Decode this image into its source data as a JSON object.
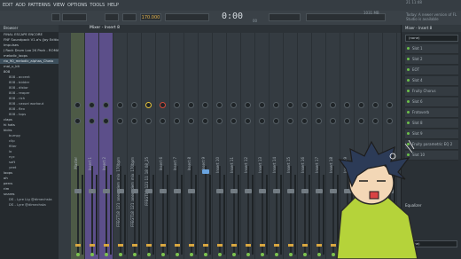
{
  "menubar": {
    "items": [
      "EDIT",
      "ADD",
      "PATTERNS",
      "VIEW",
      "OPTIONS",
      "TOOLS",
      "HELP"
    ]
  },
  "toolbar": {
    "bpm": "170.000",
    "time_main": "0:00",
    "time_small": "00",
    "song_pos": "21 11:48",
    "cpu": "1031 MB",
    "hint": "Today: A newer version of FL Studio is available"
  },
  "browser": {
    "title": "Browser",
    "rows": [
      {
        "label": "FINAL ESCAPE ENCORE",
        "folder": true
      },
      {
        "label": "FNF Soundpack V1.a's (Joy Edition)",
        "folder": true
      },
      {
        "label": "Impulses",
        "folder": true
      },
      {
        "label": "J Rock Drum Loo 2K Pack - ROMANDE",
        "folder": true
      },
      {
        "label": "melodic_loops",
        "folder": true
      },
      {
        "label": "rio_90_melodic_alphas_Chwio",
        "folder": true,
        "sel": true
      },
      {
        "label": "mal_u_kit",
        "folder": true
      },
      {
        "label": "808",
        "folder": true
      },
      {
        "label": "808 - accent",
        "folder": false
      },
      {
        "label": "808 - bidder",
        "folder": false
      },
      {
        "label": "808 - distor",
        "folder": false
      },
      {
        "label": "808 - reaper",
        "folder": false
      },
      {
        "label": "808 - rich",
        "folder": false
      },
      {
        "label": "808 - cassei workout",
        "folder": false
      },
      {
        "label": "808 - flex",
        "folder": false
      },
      {
        "label": "808 - tops",
        "folder": false
      },
      {
        "label": "claps",
        "folder": true
      },
      {
        "label": "hi hats",
        "folder": true
      },
      {
        "label": "kicks",
        "folder": true
      },
      {
        "label": "bumpy",
        "folder": false
      },
      {
        "label": "clip",
        "folder": false
      },
      {
        "label": "filter",
        "folder": false
      },
      {
        "label": "lo",
        "folder": false
      },
      {
        "label": "nyc",
        "folder": false
      },
      {
        "label": "soft",
        "folder": false
      },
      {
        "label": "yeet",
        "folder": false
      },
      {
        "label": "loops",
        "folder": true
      },
      {
        "label": "oh",
        "folder": true
      },
      {
        "label": "percs",
        "folder": true
      },
      {
        "label": "rim",
        "folder": true
      },
      {
        "label": "snares",
        "folder": true
      },
      {
        "label": "DS - Lyre Lig @dimechsta",
        "folder": false
      },
      {
        "label": "DS - Lyre @dimechsta",
        "folder": false
      }
    ]
  },
  "mixer": {
    "title": "Mixer - Insert 8",
    "strips": [
      {
        "label": "Master"
      },
      {
        "label": "Insert 1"
      },
      {
        "label": "Insert 2"
      },
      {
        "label": "FFEGT18_121_anew_dem_mix_170bpm"
      },
      {
        "label": "FFEGT18_121_anew_dem_mix_170bpm"
      },
      {
        "label": "FFEGT18_121 11_18_08_25"
      },
      {
        "label": "Insert 6"
      },
      {
        "label": "Insert 7"
      },
      {
        "label": "Insert 8"
      },
      {
        "label": "Insert 9"
      },
      {
        "label": "Insert 10"
      },
      {
        "label": "Insert 11"
      },
      {
        "label": "Insert 12"
      },
      {
        "label": "Insert 13"
      },
      {
        "label": "Insert 14"
      },
      {
        "label": "Insert 15"
      },
      {
        "label": "Insert 16"
      },
      {
        "label": "Insert 17"
      },
      {
        "label": "Insert 18"
      },
      {
        "label": "Insert 19"
      },
      {
        "label": "Insert 20"
      },
      {
        "label": "Insert 21"
      },
      {
        "label": "Insert 22"
      }
    ]
  },
  "insert": {
    "title": "Mixer - Insert 8",
    "input": "(none)",
    "output": "(none)",
    "slots": [
      "Slot 1",
      "Slot 2",
      "EOT",
      "Slot 4",
      "Fruity Chorus",
      "Slot 6",
      "Frotoverb",
      "Slot 8",
      "Slot 9",
      "Fruity parametric EQ 2",
      "Slot 10"
    ],
    "eq_label": "Equalizer"
  },
  "colors": {
    "accent": "#5c4f8a",
    "green": "#7cc24e",
    "orange": "#d8a640"
  }
}
